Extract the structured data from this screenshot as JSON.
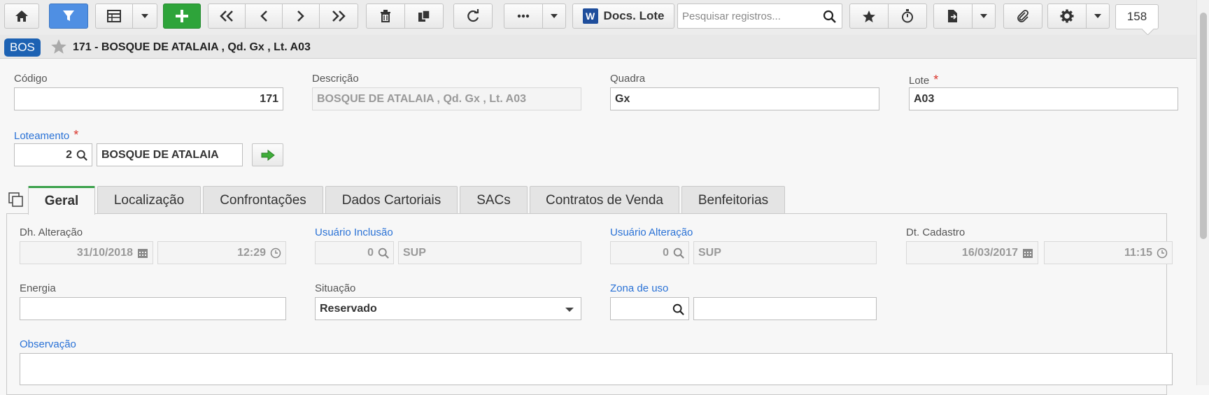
{
  "toolbar": {
    "docs_label": "Docs. Lote",
    "word_letter": "W",
    "search_placeholder": "Pesquisar registros...",
    "record_count": "158"
  },
  "record": {
    "badge": "BOS",
    "title": "171 - BOSQUE DE ATALAIA , Qd. Gx , Lt. A03"
  },
  "form": {
    "codigo": {
      "label": "Código",
      "value": "171"
    },
    "descricao": {
      "label": "Descrição",
      "value": "BOSQUE DE ATALAIA ,  Qd. Gx ,  Lt. A03"
    },
    "quadra": {
      "label": "Quadra",
      "value": "Gx"
    },
    "lote": {
      "label": "Lote",
      "value": "A03"
    },
    "loteamento": {
      "label": "Loteamento",
      "code": "2",
      "name": "BOSQUE DE ATALAIA"
    },
    "required_mark": "*"
  },
  "tabs": [
    {
      "label": "Geral"
    },
    {
      "label": "Localização"
    },
    {
      "label": "Confrontações"
    },
    {
      "label": "Dados Cartoriais"
    },
    {
      "label": "SACs"
    },
    {
      "label": "Contratos de Venda"
    },
    {
      "label": "Benfeitorias"
    }
  ],
  "geral": {
    "dh_alteracao": {
      "label": "Dh. Alteração",
      "date": "31/10/2018",
      "time": "12:29"
    },
    "usuario_inclusao": {
      "label": "Usuário Inclusão",
      "code": "0",
      "name": "SUP"
    },
    "usuario_alteracao": {
      "label": "Usuário Alteração",
      "code": "0",
      "name": "SUP"
    },
    "dt_cadastro": {
      "label": "Dt. Cadastro",
      "date": "16/03/2017",
      "time": "11:15"
    },
    "energia": {
      "label": "Energia",
      "value": ""
    },
    "situacao": {
      "label": "Situação",
      "value": "Reservado"
    },
    "zona_de_uso": {
      "label": "Zona de uso",
      "code": "",
      "name": ""
    },
    "observacao": {
      "label": "Observação",
      "value": ""
    }
  },
  "colors": {
    "accent_blue": "#4f8fe3",
    "add_green": "#2ea43a",
    "badge_blue": "#1d62b3",
    "link_blue": "#2a72d6",
    "required_red": "#d9342b",
    "active_tab": "#3aa14a"
  }
}
